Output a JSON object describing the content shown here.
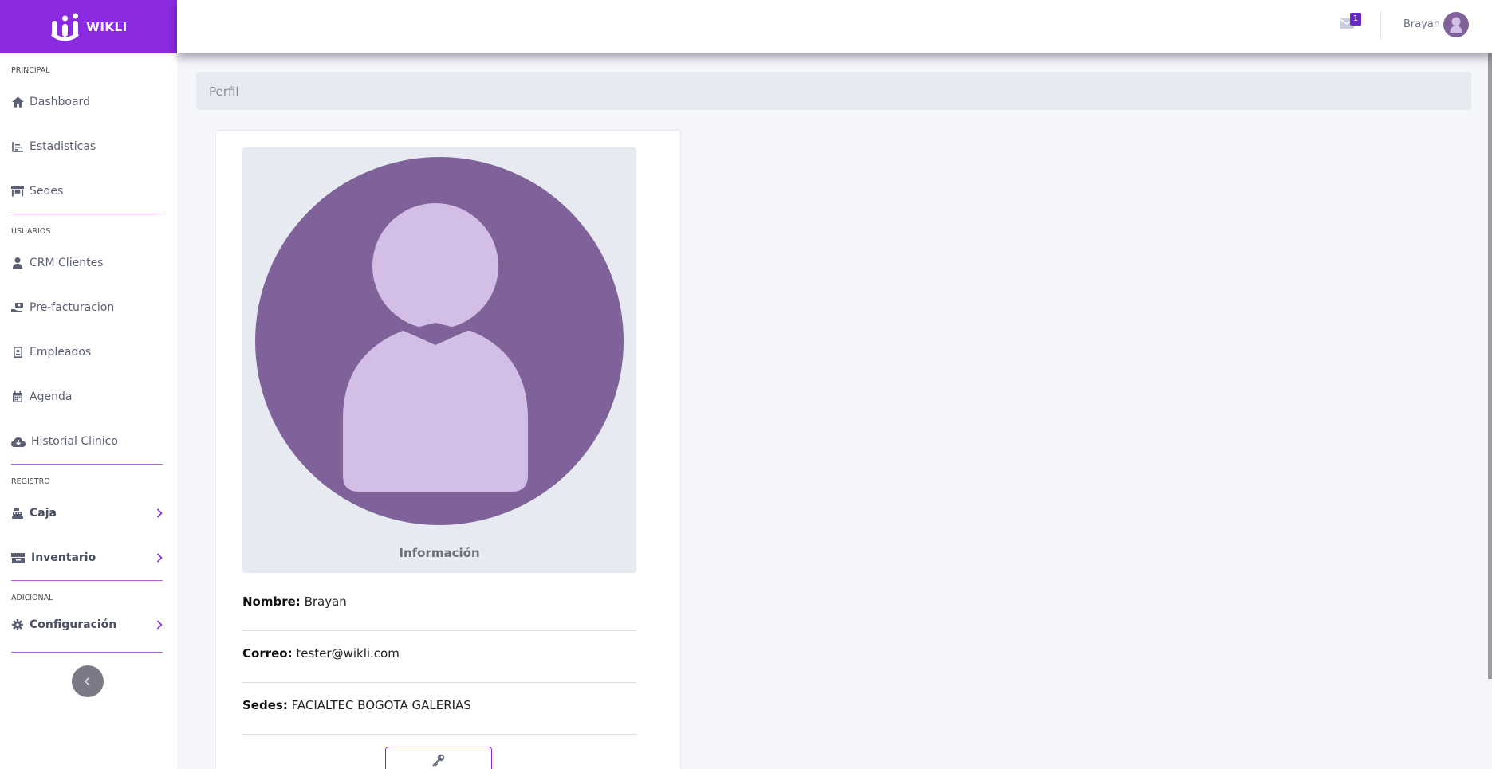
{
  "brand": {
    "name": "WIKLI",
    "color": "#8a2be2"
  },
  "sidebar": {
    "sections": [
      {
        "title": "PRINCIPAL",
        "items": [
          {
            "label": "Dashboard",
            "icon": "home-icon"
          },
          {
            "label": "Estadisticas",
            "icon": "chart-icon"
          },
          {
            "label": "Sedes",
            "icon": "store-icon"
          }
        ]
      },
      {
        "title": "USUARIOS",
        "items": [
          {
            "label": "CRM Clientes",
            "icon": "user-icon"
          },
          {
            "label": "Pre-facturacion",
            "icon": "money-hand-icon"
          },
          {
            "label": "Empleados",
            "icon": "id-badge-icon"
          },
          {
            "label": "Agenda",
            "icon": "calendar-icon"
          },
          {
            "label": "Historial Clinico",
            "icon": "cloud-download-icon"
          }
        ]
      },
      {
        "title": "REGISTRO",
        "items": [
          {
            "label": "Caja",
            "icon": "cash-register-icon"
          },
          {
            "label": "Inventario",
            "icon": "boxes-icon"
          }
        ]
      },
      {
        "title": "ADICIONAL",
        "items": [
          {
            "label": "Configuración",
            "icon": "gear-icon"
          }
        ]
      }
    ]
  },
  "topbar": {
    "messages_count": "1",
    "user_name": "Brayan"
  },
  "breadcrumb": {
    "title": "Perfil"
  },
  "profile": {
    "section_title": "Información",
    "name_label": "Nombre:",
    "name_value": "Brayan",
    "email_label": "Correo:",
    "email_value": "tester@wikli.com",
    "sedes_label": "Sedes:",
    "sedes_value": "FACIALTEC BOGOTA GALERIAS"
  },
  "colors": {
    "accent": "#8a2be2",
    "avatar_bg": "#80629b",
    "avatar_fg": "#d3bfe6"
  }
}
